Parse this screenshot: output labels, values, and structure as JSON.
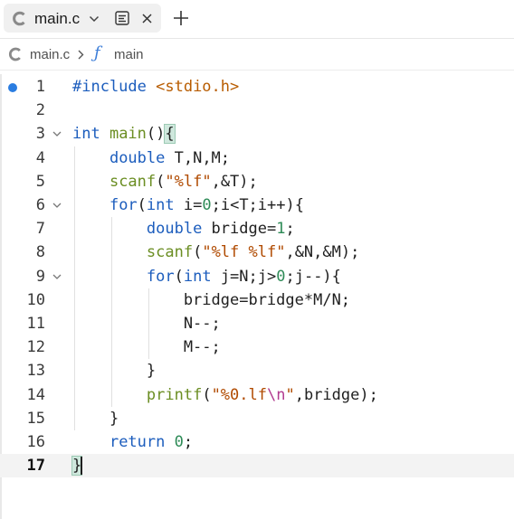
{
  "tab": {
    "label": "main.c"
  },
  "breadcrumb": {
    "file": "main.c",
    "symbol": "main"
  },
  "editor": {
    "current_line": 17,
    "breakpoint_line": 1,
    "lines": [
      {
        "n": "1",
        "fold": false,
        "segs": [
          [
            "pp",
            "#include "
          ],
          [
            "hd",
            "<stdio.h>"
          ]
        ]
      },
      {
        "n": "2",
        "fold": false,
        "segs": []
      },
      {
        "n": "3",
        "fold": true,
        "segs": [
          [
            "kw",
            "int "
          ],
          [
            "fn",
            "main"
          ],
          [
            "",
            "()"
          ],
          [
            "hl",
            "{"
          ]
        ]
      },
      {
        "n": "4",
        "fold": false,
        "segs": [
          [
            "",
            "    "
          ],
          [
            "kw",
            "double "
          ],
          [
            "",
            "T,N,M;"
          ]
        ]
      },
      {
        "n": "5",
        "fold": false,
        "segs": [
          [
            "",
            "    "
          ],
          [
            "fn",
            "scanf"
          ],
          [
            "",
            "("
          ],
          [
            "st",
            "\"%lf\""
          ],
          [
            "",
            ",&T);"
          ]
        ]
      },
      {
        "n": "6",
        "fold": true,
        "segs": [
          [
            "",
            "    "
          ],
          [
            "kw",
            "for"
          ],
          [
            "",
            "("
          ],
          [
            "kw",
            "int "
          ],
          [
            "",
            "i="
          ],
          [
            "nm",
            "0"
          ],
          [
            "",
            ";i<T;i++){"
          ]
        ]
      },
      {
        "n": "7",
        "fold": false,
        "segs": [
          [
            "",
            "        "
          ],
          [
            "kw",
            "double "
          ],
          [
            "",
            "bridge="
          ],
          [
            "nm",
            "1"
          ],
          [
            "",
            ";"
          ]
        ]
      },
      {
        "n": "8",
        "fold": false,
        "segs": [
          [
            "",
            "        "
          ],
          [
            "fn",
            "scanf"
          ],
          [
            "",
            "("
          ],
          [
            "st",
            "\"%lf %lf\""
          ],
          [
            "",
            ",&N,&M);"
          ]
        ]
      },
      {
        "n": "9",
        "fold": true,
        "segs": [
          [
            "",
            "        "
          ],
          [
            "kw",
            "for"
          ],
          [
            "",
            "("
          ],
          [
            "kw",
            "int "
          ],
          [
            "",
            "j=N;j>"
          ],
          [
            "nm",
            "0"
          ],
          [
            "",
            ";j--){"
          ]
        ]
      },
      {
        "n": "10",
        "fold": false,
        "segs": [
          [
            "",
            "            bridge=bridge*M/N;"
          ]
        ]
      },
      {
        "n": "11",
        "fold": false,
        "segs": [
          [
            "",
            "            N--;"
          ]
        ]
      },
      {
        "n": "12",
        "fold": false,
        "segs": [
          [
            "",
            "            M--;"
          ]
        ]
      },
      {
        "n": "13",
        "fold": false,
        "segs": [
          [
            "",
            "        }"
          ]
        ]
      },
      {
        "n": "14",
        "fold": false,
        "segs": [
          [
            "",
            "        "
          ],
          [
            "fn",
            "printf"
          ],
          [
            "",
            "("
          ],
          [
            "st",
            "\"%0.lf"
          ],
          [
            "es",
            "\\n"
          ],
          [
            "st",
            "\""
          ],
          [
            "",
            ",bridge);"
          ]
        ]
      },
      {
        "n": "15",
        "fold": false,
        "segs": [
          [
            "",
            "    }"
          ]
        ]
      },
      {
        "n": "16",
        "fold": false,
        "segs": [
          [
            "",
            "    "
          ],
          [
            "kw",
            "return "
          ],
          [
            "nm",
            "0"
          ],
          [
            "",
            ";"
          ]
        ]
      },
      {
        "n": "17",
        "fold": false,
        "segs": [
          [
            "hl",
            "}"
          ]
        ]
      }
    ]
  }
}
